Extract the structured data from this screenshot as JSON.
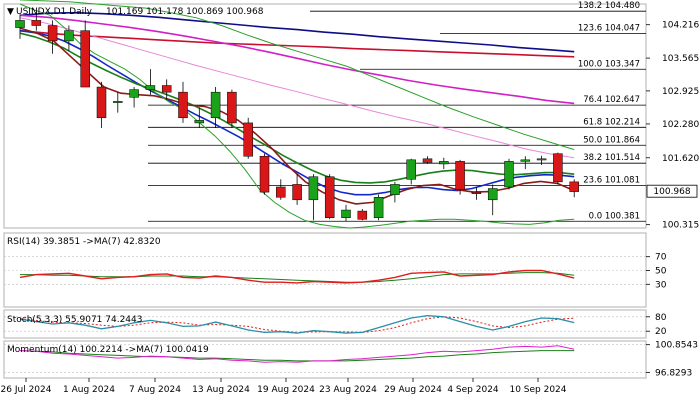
{
  "chart_data": {
    "type": "candlestick",
    "title": "USINDX,D1 Daily",
    "header_values": "101.169 101.178 100.869 100.968",
    "dates": [
      "26 Jul 2024",
      "1 Aug 2024",
      "7 Aug 2024",
      "13 Aug 2024",
      "19 Aug 2024",
      "23 Aug 2024",
      "29 Aug 2024",
      "4 Sep 2024",
      "10 Sep 2024"
    ],
    "price_axis": {
      "ticks": [
        "104.216",
        "103.565",
        "102.925",
        "102.280",
        "101.620",
        "100.968",
        "100.315"
      ],
      "current_price": "100.968",
      "ylim": [
        100.25,
        104.62
      ]
    },
    "fib_levels": [
      {
        "label": "138.2 104.480",
        "value": 104.48
      },
      {
        "label": "123.6 104.047",
        "value": 104.047
      },
      {
        "label": "100.0 103.347",
        "value": 103.347
      },
      {
        "label": "76.4 102.647",
        "value": 102.647
      },
      {
        "label": "61.8 102.214",
        "value": 102.214
      },
      {
        "label": "50.0 101.864",
        "value": 101.864
      },
      {
        "label": "38.2 101.514",
        "value": 101.514
      },
      {
        "label": "23.6 101.081",
        "value": 101.081
      },
      {
        "label": "0.0 100.381",
        "value": 100.381
      }
    ],
    "candles": [
      {
        "o": 104.16,
        "h": 104.42,
        "l": 103.94,
        "c": 104.3
      },
      {
        "o": 104.3,
        "h": 104.45,
        "l": 104.1,
        "c": 104.2
      },
      {
        "o": 104.2,
        "h": 104.3,
        "l": 103.65,
        "c": 103.9
      },
      {
        "o": 103.9,
        "h": 104.2,
        "l": 103.7,
        "c": 104.1
      },
      {
        "o": 104.1,
        "h": 104.3,
        "l": 103.0,
        "c": 103.0
      },
      {
        "o": 103.0,
        "h": 103.1,
        "l": 102.2,
        "c": 102.4
      },
      {
        "o": 102.7,
        "h": 102.9,
        "l": 102.5,
        "c": 102.72
      },
      {
        "o": 102.8,
        "h": 103.0,
        "l": 102.6,
        "c": 102.95
      },
      {
        "o": 102.95,
        "h": 103.35,
        "l": 102.85,
        "c": 103.03
      },
      {
        "o": 103.03,
        "h": 103.15,
        "l": 102.75,
        "c": 102.9
      },
      {
        "o": 102.9,
        "h": 103.1,
        "l": 102.3,
        "c": 102.4
      },
      {
        "o": 102.3,
        "h": 102.6,
        "l": 102.2,
        "c": 102.35
      },
      {
        "o": 102.4,
        "h": 103.0,
        "l": 102.2,
        "c": 102.9
      },
      {
        "o": 102.9,
        "h": 102.95,
        "l": 102.2,
        "c": 102.3
      },
      {
        "o": 102.3,
        "h": 102.4,
        "l": 101.6,
        "c": 101.65
      },
      {
        "o": 101.65,
        "h": 101.7,
        "l": 100.9,
        "c": 100.95
      },
      {
        "o": 101.05,
        "h": 101.2,
        "l": 100.8,
        "c": 100.85
      },
      {
        "o": 101.1,
        "h": 101.3,
        "l": 100.7,
        "c": 100.8
      },
      {
        "o": 100.8,
        "h": 101.3,
        "l": 100.4,
        "c": 101.25
      },
      {
        "o": 101.25,
        "h": 101.3,
        "l": 100.42,
        "c": 100.45
      },
      {
        "o": 100.45,
        "h": 100.7,
        "l": 100.38,
        "c": 100.6
      },
      {
        "o": 100.58,
        "h": 100.62,
        "l": 100.4,
        "c": 100.42
      },
      {
        "o": 100.45,
        "h": 100.9,
        "l": 100.4,
        "c": 100.85
      },
      {
        "o": 100.9,
        "h": 101.15,
        "l": 100.75,
        "c": 101.1
      },
      {
        "o": 101.2,
        "h": 101.6,
        "l": 101.1,
        "c": 101.58
      },
      {
        "o": 101.6,
        "h": 101.65,
        "l": 101.5,
        "c": 101.53
      },
      {
        "o": 101.5,
        "h": 101.62,
        "l": 101.4,
        "c": 101.55
      },
      {
        "o": 101.55,
        "h": 101.58,
        "l": 100.9,
        "c": 101.0
      },
      {
        "o": 100.95,
        "h": 101.05,
        "l": 100.8,
        "c": 100.92
      },
      {
        "o": 100.8,
        "h": 101.1,
        "l": 100.5,
        "c": 101.02
      },
      {
        "o": 101.05,
        "h": 101.6,
        "l": 101.0,
        "c": 101.55
      },
      {
        "o": 101.55,
        "h": 101.65,
        "l": 101.4,
        "c": 101.58
      },
      {
        "o": 101.58,
        "h": 101.66,
        "l": 101.48,
        "c": 101.6
      },
      {
        "o": 101.7,
        "h": 101.72,
        "l": 101.1,
        "c": 101.15
      },
      {
        "o": 101.15,
        "h": 101.2,
        "l": 100.85,
        "c": 100.96
      }
    ],
    "moving_averages": [
      {
        "color": "#0d0d8a",
        "values": [
          104.4,
          104.44,
          104.45,
          104.43,
          104.4,
          104.36,
          104.31,
          104.26,
          104.21,
          104.16,
          104.12,
          104.07,
          104.03,
          103.98,
          103.94,
          103.9,
          103.86,
          103.82,
          103.77,
          103.73,
          103.69
        ]
      },
      {
        "color": "#c8102e",
        "values": [
          104.1,
          104.05,
          104.01,
          103.98,
          103.95,
          103.92,
          103.89,
          103.86,
          103.84,
          103.82,
          103.8,
          103.78,
          103.75,
          103.73,
          103.71,
          103.69,
          103.67,
          103.65,
          103.63,
          103.61,
          103.59
        ]
      },
      {
        "color": "#d020c8",
        "values": [
          104.4,
          104.36,
          104.3,
          104.23,
          104.16,
          104.08,
          103.99,
          103.89,
          103.79,
          103.68,
          103.56,
          103.44,
          103.33,
          103.23,
          103.13,
          103.04,
          102.96,
          102.89,
          102.82,
          102.74,
          102.68
        ]
      },
      {
        "color": "#e887d8",
        "values": [
          104.35,
          104.25,
          104.12,
          103.98,
          103.84,
          103.7,
          103.56,
          103.42,
          103.29,
          103.16,
          103.03,
          102.91,
          102.78,
          102.66,
          102.53,
          102.41,
          102.3,
          102.18,
          102.05,
          101.93,
          101.8,
          101.7,
          101.62
        ]
      },
      {
        "color": "#1428c8",
        "values": [
          104.1,
          104.06,
          104.0,
          103.9,
          103.76,
          103.6,
          103.42,
          103.25,
          103.08,
          102.92,
          102.77,
          102.62,
          102.47,
          102.33,
          102.18,
          102.03,
          101.86,
          101.68,
          101.5,
          101.34,
          101.18,
          101.04,
          100.95,
          100.9,
          100.9,
          100.94,
          101.0,
          101.04,
          101.04,
          101.0,
          100.98,
          101.02,
          101.1,
          101.18,
          101.24,
          101.27,
          101.29,
          101.28,
          101.25
        ]
      },
      {
        "color": "#1a7f1a",
        "values": [
          104.05,
          103.98,
          103.88,
          103.76,
          103.6,
          103.45,
          103.31,
          103.18,
          103.06,
          102.96,
          102.86,
          102.75,
          102.63,
          102.49,
          102.34,
          102.17,
          102.0,
          101.84,
          101.67,
          101.52,
          101.38,
          101.26,
          101.18,
          101.14,
          101.13,
          101.15,
          101.2,
          101.26,
          101.32,
          101.36,
          101.38,
          101.37,
          101.33,
          101.3,
          101.29,
          101.31,
          101.33,
          101.33,
          101.3
        ]
      },
      {
        "color": "#8b1a1a",
        "values": [
          104.15,
          104.05,
          103.9,
          103.6,
          103.3,
          103.0,
          102.88,
          102.85,
          102.83,
          102.75,
          102.65,
          102.62,
          102.52,
          102.35,
          102.1,
          101.8,
          101.45,
          101.15,
          100.95,
          100.8,
          100.72,
          100.75,
          100.88,
          101.0,
          101.08,
          101.1,
          101.0,
          100.95,
          100.96,
          101.02,
          101.12,
          101.16,
          101.12,
          100.98
        ]
      },
      {
        "color": "#2aa02a",
        "values": [
          104.62,
          104.5,
          104.4,
          104.15,
          103.85,
          103.65,
          103.5,
          103.35,
          103.15,
          102.9,
          102.7,
          102.55,
          102.3,
          102.05,
          101.75,
          101.4,
          101.0,
          100.75,
          100.55,
          100.4,
          100.32,
          100.28,
          100.25,
          100.27,
          100.3,
          100.34,
          100.38,
          100.4,
          100.42,
          100.42,
          100.4,
          100.38,
          100.35,
          100.33,
          100.32,
          100.35,
          100.4,
          100.42
        ]
      },
      {
        "color": "#2aa02a",
        "values": [
          104.7,
          104.68,
          104.66,
          104.62,
          104.58,
          104.54,
          104.45,
          104.35,
          104.2,
          104.02,
          103.85,
          103.7,
          103.55,
          103.4,
          103.2,
          103.0,
          102.8,
          102.6,
          102.42,
          102.25,
          102.08,
          101.93,
          101.78
        ]
      }
    ],
    "rsi": {
      "label": "RSI(14) 39.3851 ->MA(7) 42.8320",
      "ticks": [
        "70",
        "50",
        "30"
      ],
      "ylim": [
        0,
        100
      ],
      "line_color": "#e11d1d",
      "ma_color": "#1a7f1a",
      "values": [
        40,
        44,
        45,
        46,
        42,
        38,
        40,
        41,
        44,
        45,
        40,
        39,
        42,
        40,
        36,
        33,
        33,
        32,
        34,
        33,
        32,
        33,
        36,
        40,
        46,
        47,
        48,
        42,
        43,
        44,
        48,
        50,
        50,
        45,
        39
      ],
      "ma_values": [
        44,
        44,
        43,
        43,
        42,
        41,
        41,
        41,
        42,
        42,
        42,
        41,
        41,
        40,
        39,
        38,
        37,
        36,
        35,
        34,
        33,
        33,
        34,
        36,
        38,
        41,
        44,
        45,
        45,
        45,
        46,
        47,
        47,
        46,
        43
      ]
    },
    "stochastic": {
      "label": "Stoch(5,3,3) 55.9071 74.2443",
      "ticks": [
        "80",
        "20"
      ],
      "ylim": [
        0,
        100
      ],
      "line_color": "#2a8fa8",
      "signal_color": "#e11d1d",
      "values": [
        70,
        60,
        50,
        55,
        45,
        30,
        40,
        55,
        65,
        55,
        40,
        42,
        58,
        42,
        25,
        15,
        18,
        12,
        22,
        18,
        12,
        15,
        35,
        55,
        75,
        85,
        80,
        60,
        40,
        25,
        40,
        60,
        75,
        72,
        56
      ],
      "signal_values": [
        72,
        65,
        58,
        55,
        52,
        45,
        40,
        45,
        55,
        58,
        55,
        45,
        48,
        45,
        40,
        27,
        20,
        15,
        17,
        18,
        17,
        15,
        22,
        35,
        55,
        72,
        80,
        75,
        60,
        42,
        35,
        42,
        58,
        70,
        74
      ]
    },
    "momentum": {
      "label": "Momentum(14) 100.2214 ->MA(7) 100.0419",
      "ticks": [
        "100.8543",
        "96.8293"
      ],
      "ylim": [
        96.3,
        101.1
      ],
      "line_color": "#e020d0",
      "ma_color": "#1a7f1a",
      "values": [
        100.0,
        99.9,
        99.6,
        99.5,
        99.3,
        99.1,
        98.9,
        99.0,
        99.2,
        99.1,
        98.9,
        98.7,
        98.8,
        98.6,
        98.5,
        98.3,
        98.4,
        98.3,
        98.5,
        98.5,
        98.7,
        98.8,
        99.0,
        99.2,
        99.4,
        99.7,
        99.9,
        99.8,
        100.0,
        100.2,
        100.5,
        100.6,
        100.5,
        100.7,
        100.2
      ],
      "ma_values": [
        100.0,
        99.9,
        99.8,
        99.6,
        99.5,
        99.4,
        99.3,
        99.2,
        99.1,
        99.1,
        99.0,
        98.9,
        98.9,
        98.8,
        98.7,
        98.6,
        98.6,
        98.5,
        98.5,
        98.5,
        98.5,
        98.6,
        98.7,
        98.8,
        98.9,
        99.1,
        99.2,
        99.4,
        99.5,
        99.7,
        99.8,
        99.9,
        100.0,
        100.0,
        100.0
      ]
    }
  }
}
